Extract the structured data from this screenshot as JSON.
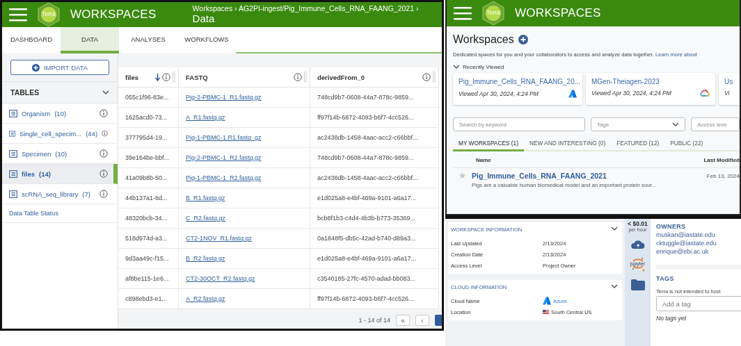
{
  "data_view": {
    "header": {
      "logo_text": "Terra",
      "app_title": "WORKSPACES",
      "breadcrumb": "Workspaces › AG2PI-ingest/Pig_Immune_Cells_RNA_FAANG_2021 ›",
      "page_title": "Data"
    },
    "tabs": [
      {
        "label": "DASHBOARD",
        "selected": false
      },
      {
        "label": "DATA",
        "selected": true
      },
      {
        "label": "ANALYSES",
        "selected": false
      },
      {
        "label": "WORKFLOWS",
        "selected": false
      }
    ],
    "import_button": "IMPORT DATA",
    "tables_title": "TABLES",
    "tables": [
      {
        "name": "Organism",
        "count": "(10)",
        "selected": false
      },
      {
        "name": "Single_cell_specim...",
        "count": "(44)",
        "selected": false
      },
      {
        "name": "Specimen",
        "count": "(10)",
        "selected": false
      },
      {
        "name": "files",
        "count": "(14)",
        "selected": true
      },
      {
        "name": "scRNA_seq_library",
        "count": "(7)",
        "selected": false
      }
    ],
    "status_link": "Data Table Status",
    "columns": [
      {
        "label": "files",
        "sorted": true
      },
      {
        "label": "FASTQ",
        "sorted": false
      },
      {
        "label": "derivedFrom_0",
        "sorted": false
      }
    ],
    "rows": [
      [
        "055c1f96-83e...",
        "Pig-2-PBMC-1_R1.fastq.gz",
        "748cd9b7-0608-44a7-878c-9859..."
      ],
      [
        "1625acd0-73...",
        "A_R1.fastq.gz",
        "ff97f14b-6872-4093-b6f7-4cc526..."
      ],
      [
        "377795d4-19...",
        "Pig-1-PBMC-1.R1.fastq_gz",
        "ac2438db-1458-4aac-acc2-c66bbf..."
      ],
      [
        "39e164be-bbf...",
        "Pig-2-PBMC-1_R2.fastq.gz",
        "748cd9b7-0608-44a7-878c-9859..."
      ],
      [
        "41a09b8b-50...",
        "Pig-1-PBMC-1_R2.fastq.gz",
        "ac2438db-1458-4aac-acc2-c66bbf..."
      ],
      [
        "44b137a1-8d...",
        "B_R1.fastq.gz",
        "e1d025a8-e4bf-469a-9101-a6a17..."
      ],
      [
        "48320bcb-34...",
        "C_R2.fastq.gz",
        "bcb8f1b3-c4d4-4b3b-b773-35369..."
      ],
      [
        "518d974d-a3...",
        "CT2-1NOV_R1.fastq.gz",
        "0a1848f5-db5c-42ad-b740-d89a3..."
      ],
      [
        "9d3aa49c-f15...",
        "B_R2.fastq.gz",
        "e1d025a8-e4bf-469a-9101-a6a17..."
      ],
      [
        "af8be115-1e6...",
        "CT2-30OCT_R2.fastq.gz",
        "c3540185-27fc-4570-adad-bb083..."
      ],
      [
        "c898ebd3-e1...",
        "A_R2.fastq.gz",
        "ff97f14b-6872-4093-b6f7-4cc526..."
      ]
    ],
    "pagination": {
      "range": "1 - 14 of 14",
      "first": "«",
      "previous": "‹"
    }
  },
  "workspaces_view": {
    "header": {
      "logo_text": "Terra",
      "app_title": "WORKSPACES"
    },
    "title": "Workspaces",
    "description": "Dedicated spaces for you and your collaborators to access and analyze data together.",
    "learn_more": "Learn more about",
    "recently_viewed": {
      "label": "Recently Viewed",
      "expanded": true
    },
    "cards": [
      {
        "name": "Pig_Immune_Cells_RNA_FAANG_20...",
        "viewed": "Viewed Apr 30, 2024, 4:24 PM",
        "kind": "azure"
      },
      {
        "name": "MGen-Theiagen-2023",
        "viewed": "Viewed Apr 30, 2024, 4:24 PM",
        "kind": "gcp"
      },
      {
        "name": "Us",
        "viewed": "Vi",
        "kind": "none"
      }
    ],
    "search": {
      "placeholder": "Search by keyword"
    },
    "tags_filter": {
      "placeholder": "Tags"
    },
    "access_filter": {
      "placeholder": "Access leve"
    },
    "tabs": [
      {
        "label": "MY WORKSPACES (1)",
        "selected": true
      },
      {
        "label": "NEW AND INTERESTING (0)",
        "selected": false
      },
      {
        "label": "FEATURED (12)",
        "selected": false
      },
      {
        "label": "PUBLIC (22)",
        "selected": false
      }
    ],
    "columns": [
      "Name",
      "Last Modified"
    ],
    "rows": [
      {
        "name": "Pig_Immune_Cells_RNA_FAANG_2021",
        "description": "Pigs are a valuable human biomedical model and an important protein sour...",
        "modified": "Feb 13, 2024",
        "starred": false
      }
    ]
  },
  "dashboard_view": {
    "sections": [
      {
        "title": "WORKSPACE INFORMATION",
        "expanded": true,
        "fields": [
          {
            "label": "Last Updated",
            "value": "2/13/2024",
            "kind": "text"
          },
          {
            "label": "Creation Date",
            "value": "2/13/2024",
            "kind": "text"
          },
          {
            "label": "Access Level",
            "value": "Project Owner",
            "kind": "text"
          }
        ]
      },
      {
        "title": "CLOUD INFORMATION",
        "expanded": true,
        "fields": [
          {
            "label": "Cloud Name",
            "value": "Azure",
            "kind": "cloud"
          },
          {
            "label": "Location",
            "value": "South Central US",
            "kind": "region"
          }
        ]
      }
    ],
    "cost": {
      "amount": "< $0.01",
      "unit": "per hour"
    },
    "jupyter_label": "jupyter",
    "owners_title": "OWNERS",
    "owners": [
      "muskan@iastate.edu",
      "cktuggle@iastate.edu",
      "enrique@ebi.ac.uk"
    ],
    "tags_title": "TAGS",
    "tags_note": "Terra is not intended to host",
    "tag_input": {
      "placeholder": "Add a tag"
    },
    "no_tags": "No tags yet"
  }
}
